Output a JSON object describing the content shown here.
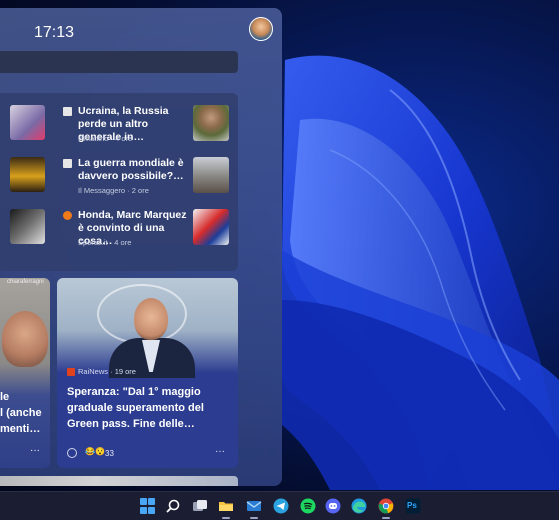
{
  "panel": {
    "clock": "17:13",
    "news": [
      {
        "headline": "Ucraina, la Russia perde un altro generale in…",
        "source": "Il Mattino",
        "time": "4 ore"
      },
      {
        "headline": "La guerra mondiale è davvero possibile?…",
        "source": "Il Messaggero",
        "time": "2 ore"
      },
      {
        "headline": "Honda, Marc Marquez è convinto di una cosa…",
        "source": "Sportal.it",
        "time": "4 ore"
      }
    ],
    "big_left": {
      "tag": "chiaraferragni",
      "caption_lines": [
        "le",
        "l (anche",
        "menti…"
      ]
    },
    "big_right": {
      "source": "RaiNews",
      "time": "19 ore",
      "title": "Speranza: \"Dal 1° maggio graduale superamento del Green pass. Fine delle…",
      "reaction_emojis": "😂😯",
      "reaction_count": "33"
    }
  },
  "taskbar": {
    "icons": [
      "windows-start-icon",
      "search-icon",
      "task-view-icon",
      "file-explorer-icon",
      "mail-icon",
      "telegram-icon",
      "spotify-icon",
      "discord-icon",
      "edge-icon",
      "chrome-icon",
      "photoshop-icon"
    ],
    "photoshop_label": "Ps"
  },
  "colors": {
    "accent": "#4aa7f5",
    "panel": "#3c4e8c",
    "taskbar": "#1c2034"
  }
}
